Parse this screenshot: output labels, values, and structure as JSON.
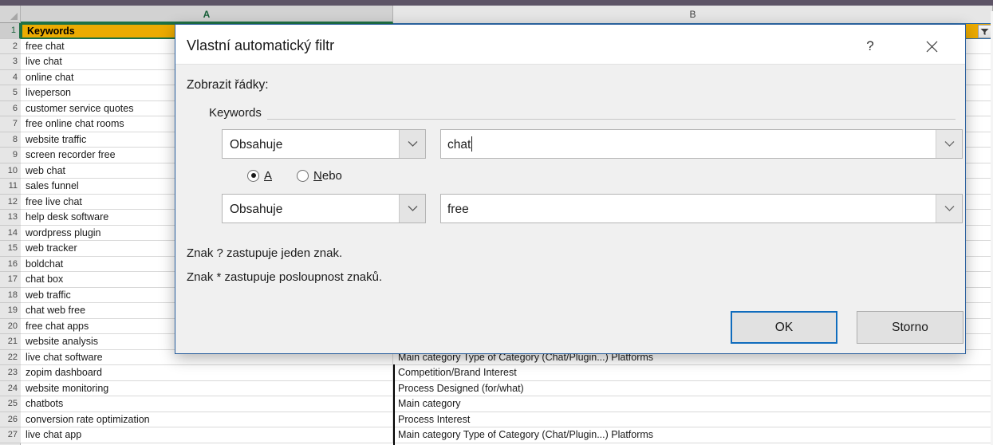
{
  "spreadsheet": {
    "columns": [
      {
        "id": "A",
        "label": "A"
      },
      {
        "id": "B",
        "label": "B"
      }
    ],
    "header_row": {
      "number": "1",
      "a": "Keywords",
      "b": ""
    },
    "filter_icon": "filter-funnel-icon",
    "rows": [
      {
        "number": "2",
        "a": "free chat",
        "b": ""
      },
      {
        "number": "3",
        "a": "live chat",
        "b": ""
      },
      {
        "number": "4",
        "a": "online chat",
        "b": ""
      },
      {
        "number": "5",
        "a": "liveperson",
        "b": ""
      },
      {
        "number": "6",
        "a": "customer service quotes",
        "b": ""
      },
      {
        "number": "7",
        "a": "free online chat rooms",
        "b": ""
      },
      {
        "number": "8",
        "a": "website traffic",
        "b": ""
      },
      {
        "number": "9",
        "a": "screen recorder free",
        "b": ""
      },
      {
        "number": "10",
        "a": "web chat",
        "b": ""
      },
      {
        "number": "11",
        "a": "sales funnel",
        "b": ""
      },
      {
        "number": "12",
        "a": "free live chat",
        "b": ""
      },
      {
        "number": "13",
        "a": "help desk software",
        "b": ""
      },
      {
        "number": "14",
        "a": "wordpress plugin",
        "b": ""
      },
      {
        "number": "15",
        "a": "web tracker",
        "b": ""
      },
      {
        "number": "16",
        "a": "boldchat",
        "b": ""
      },
      {
        "number": "17",
        "a": "chat box",
        "b": ""
      },
      {
        "number": "18",
        "a": "web traffic",
        "b": ""
      },
      {
        "number": "19",
        "a": "chat web free",
        "b": ""
      },
      {
        "number": "20",
        "a": "free chat apps",
        "b": ""
      },
      {
        "number": "21",
        "a": "website analysis",
        "b": ""
      },
      {
        "number": "22",
        "a": "live chat software",
        "b": "Main category Type of Category (Chat/Plugin...) Platforms"
      },
      {
        "number": "23",
        "a": "zopim dashboard",
        "b": "Competition/Brand Interest"
      },
      {
        "number": "24",
        "a": "website monitoring",
        "b": "Process Designed (for/what)"
      },
      {
        "number": "25",
        "a": "chatbots",
        "b": "Main category"
      },
      {
        "number": "26",
        "a": "conversion rate optimization",
        "b": "Process Interest"
      },
      {
        "number": "27",
        "a": "live chat app",
        "b": "Main category Type of Category (Chat/Plugin...) Platforms"
      }
    ]
  },
  "dialog": {
    "title": "Vlastní automatický filtr",
    "help_glyph": "?",
    "close_glyph": "✕",
    "show_rows_label": "Zobrazit řádky:",
    "group_label": "Keywords",
    "criteria": [
      {
        "operator": "Obsahuje",
        "value": "chat",
        "operator_arrow_icon": "chevron-down-icon",
        "value_arrow_icon": "chevron-down-icon"
      },
      {
        "operator": "Obsahuje",
        "value": "free",
        "operator_arrow_icon": "chevron-down-icon",
        "value_arrow_icon": "chevron-down-icon"
      }
    ],
    "conjunction": {
      "and_label": "A",
      "or_label_prefix": "N",
      "or_label_rest": "ebo",
      "selected": "and"
    },
    "hints": [
      "Znak ? zastupuje jeden znak.",
      "Znak * zastupuje posloupnost znaků."
    ],
    "buttons": {
      "ok": "OK",
      "cancel": "Storno"
    }
  },
  "colors": {
    "header_fill": "#ecab01",
    "selection_green": "#1e7145",
    "dialog_border": "#2a5f9e",
    "default_button_border": "#0f6cbd"
  }
}
